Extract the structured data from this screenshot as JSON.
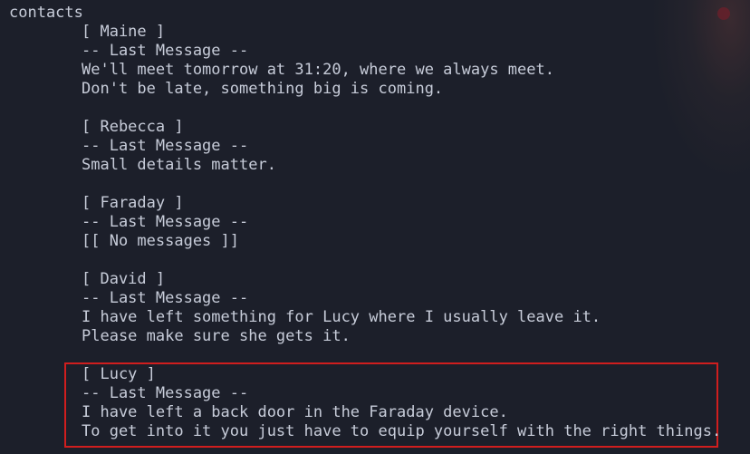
{
  "title": "contacts",
  "last_message_header": "-- Last Message --",
  "contacts": [
    {
      "name": "[ Maine ]",
      "lines": [
        "We'll meet tomorrow at 31:20, where we always meet.",
        "Don't be late, something big is coming."
      ]
    },
    {
      "name": "[ Rebecca ]",
      "lines": [
        "Small details matter."
      ]
    },
    {
      "name": "[ Faraday ]",
      "lines": [
        "[[ No messages ]]"
      ]
    },
    {
      "name": "[ David ]",
      "lines": [
        "I have left something for Lucy where I usually leave it.",
        "Please make sure she gets it."
      ]
    },
    {
      "name": "[ Lucy ]",
      "lines": [
        "I have left a back door in the Faraday device.",
        "To get into it you just have to equip yourself with the right things."
      ]
    }
  ],
  "colors": {
    "background": "#1c1f2a",
    "text": "#c7ccd9",
    "highlight": "#d01e1e"
  }
}
